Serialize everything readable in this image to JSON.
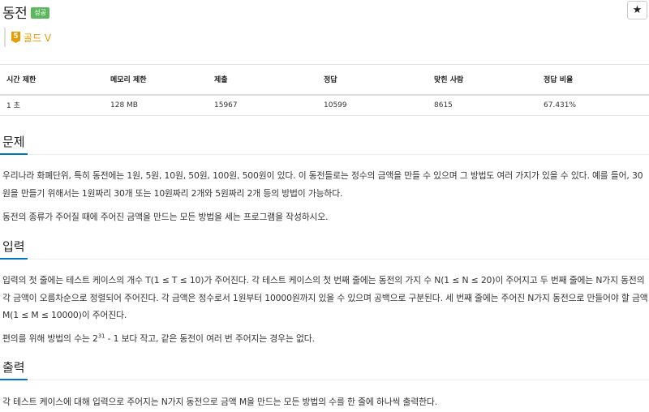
{
  "problem": {
    "title": "동전",
    "status_badge": "성공",
    "tier": {
      "number": "5",
      "label": "골드 V",
      "color": "#ec9a00"
    },
    "star_icon": "★"
  },
  "stats": {
    "headers": [
      "시간 제한",
      "메모리 제한",
      "제출",
      "정답",
      "맞힌 사람",
      "정답 비율"
    ],
    "values": [
      "1 초",
      "128 MB",
      "15967",
      "10599",
      "8615",
      "67.431%"
    ]
  },
  "sections": {
    "problem": {
      "title": "문제",
      "paragraphs": [
        "우리나라 화폐단위, 특히 동전에는 1원, 5원, 10원, 50원, 100원, 500원이 있다. 이 동전들로는 정수의 금액을 만들 수 있으며 그 방법도 여러 가지가 있을 수 있다. 예를 들어, 30원을 만들기 위해서는 1원짜리 30개 또는 10원짜리 2개와 5원짜리 2개 등의 방법이 가능하다.",
        "동전의 종류가 주어질 때에 주어진 금액을 만드는 모든 방법을 세는 프로그램을 작성하시오."
      ]
    },
    "input": {
      "title": "입력",
      "paragraph": "입력의 첫 줄에는 테스트 케이스의 개수 T(1 ≤ T ≤ 10)가 주어진다. 각 테스트 케이스의 첫 번째 줄에는 동전의 가지 수 N(1 ≤ N ≤ 20)이 주어지고 두 번째 줄에는 N가지 동전의 각 금액이 오름차순으로 정렬되어 주어진다. 각 금액은 정수로서 1원부터 10000원까지 있을 수 있으며 공백으로 구분된다. 세 번째 줄에는 주어진 N가지 동전으로 만들어야 할 금액 M(1 ≤ M ≤ 10000)이 주어진다.",
      "note_prefix": "편의를 위해 방법의 수는 2",
      "note_exponent": "31",
      "note_suffix": " - 1 보다 작고, 같은 동전이 여러 번 주어지는 경우는 없다."
    },
    "output": {
      "title": "출력",
      "paragraph": "각 테스트 케이스에 대해 입력으로 주어지는 N가지 동전으로 금액 M을 만드는 모든 방법의 수를 한 줄에 하나씩 출력한다."
    }
  }
}
